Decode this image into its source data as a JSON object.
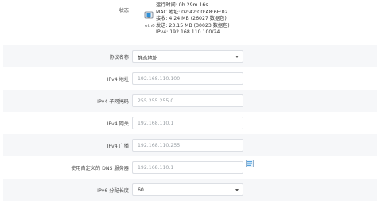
{
  "status": {
    "label": "状态",
    "interface_name": "eth0",
    "uptime": "运行时间: 0h 29m 16s",
    "mac": "MAC 地址: 02:42:C0:A8:6E:02",
    "rx": "接收: 4.24 MB (26027 数据包)",
    "tx": "发送: 23.15 MB (30023 数据包)",
    "ipv4": "IPv4: 192.168.110.100/24"
  },
  "protocol": {
    "label": "协议名称",
    "value": "静态地址"
  },
  "ipv4_address": {
    "label": "IPv4 地址",
    "value": "192.168.110.100"
  },
  "ipv4_netmask": {
    "label": "IPv4 子网掩码",
    "value": "255.255.255.0"
  },
  "ipv4_gateway": {
    "label": "IPv4 网关",
    "value": "192.168.110.1"
  },
  "ipv4_broadcast": {
    "label": "IPv4 广播",
    "value": "192.168.110.255"
  },
  "custom_dns": {
    "label": "使用自定义的 DNS 服务器",
    "value": "192.168.110.1"
  },
  "ipv6_prefix": {
    "label": "IPv6 分配长度",
    "value": "60"
  },
  "icons": {
    "interface": "ethernet-port-icon",
    "add_dns": "add-dns-icon"
  },
  "colors": {
    "row_shade": "#f6f7f9",
    "field_border": "#dcdfe4",
    "accent_icon": "#2f8fd6"
  }
}
